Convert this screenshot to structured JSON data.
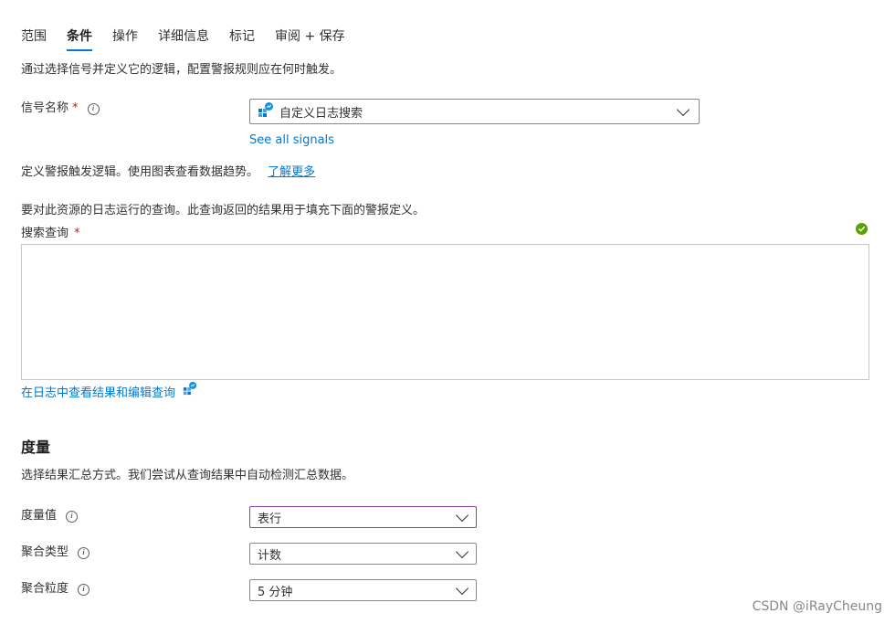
{
  "tabs": [
    {
      "label": "范围",
      "active": false
    },
    {
      "label": "条件",
      "active": true
    },
    {
      "label": "操作",
      "active": false
    },
    {
      "label": "详细信息",
      "active": false
    },
    {
      "label": "标记",
      "active": false
    },
    {
      "label": "审阅 + 保存",
      "active": false
    }
  ],
  "condition": {
    "description": "通过选择信号并定义它的逻辑，配置警报规则应在何时触发。",
    "signal_label": "信号名称",
    "required_mark": "*",
    "signal_value": "自定义日志搜索",
    "see_all_signals": "See all signals",
    "logic_description": "定义警报触发逻辑。使用图表查看数据趋势。",
    "learn_more": "了解更多",
    "query_description": "要对此资源的日志运行的查询。此查询返回的结果用于填充下面的警报定义。",
    "query_label": "搜索查询",
    "query_value": "",
    "view_in_logs": "在日志中查看结果和编辑查询"
  },
  "measurement": {
    "title": "度量",
    "description": "选择结果汇总方式。我们尝试从查询结果中自动检测汇总数据。",
    "fields": [
      {
        "label": "度量值",
        "value": "表行"
      },
      {
        "label": "聚合类型",
        "value": "计数"
      },
      {
        "label": "聚合粒度",
        "value": "5 分钟"
      }
    ]
  },
  "icons": {
    "info": "info-icon",
    "chevron": "chevron-down-icon",
    "check": "check-circle-icon",
    "signal": "log-analytics-icon"
  },
  "colors": {
    "accent": "#0078d4",
    "success": "#57a300",
    "required": "#a4262c",
    "focus_border": "#8a3f9e"
  },
  "watermark": "CSDN @iRayCheung"
}
